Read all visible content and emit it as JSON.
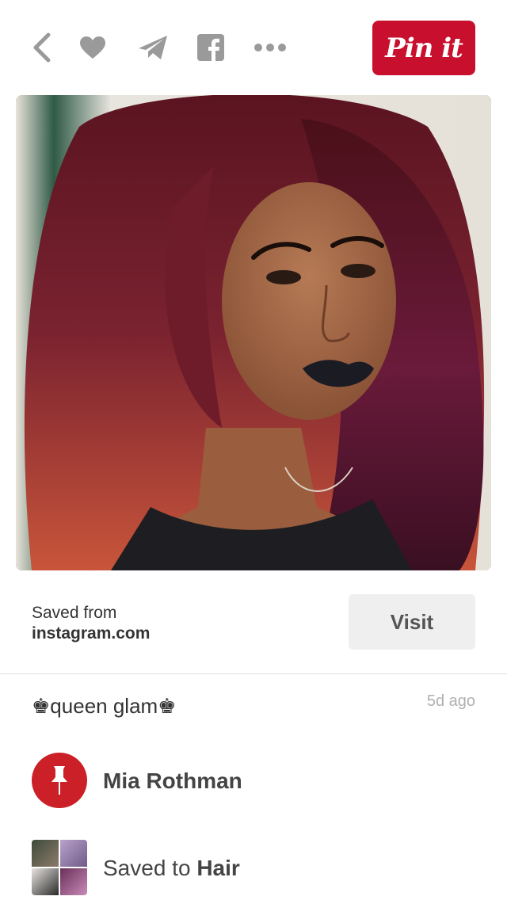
{
  "toolbar": {
    "icons": [
      "back-icon",
      "heart-icon",
      "send-icon",
      "facebook-icon",
      "more-icon"
    ],
    "pin_label": "Pin it",
    "pin_color": "#c8102e"
  },
  "pin": {
    "image_alt": "Woman with long wavy burgundy hair and dark lipstick",
    "saved_from_label": "Saved from",
    "source_domain": "instagram.com",
    "visit_label": "Visit",
    "description": "♚queen glam♚",
    "timestamp": "5d ago"
  },
  "pinner": {
    "name": "Mia Rothman",
    "avatar_color": "#cb2027"
  },
  "board": {
    "prefix": "Saved to ",
    "name": "Hair"
  }
}
